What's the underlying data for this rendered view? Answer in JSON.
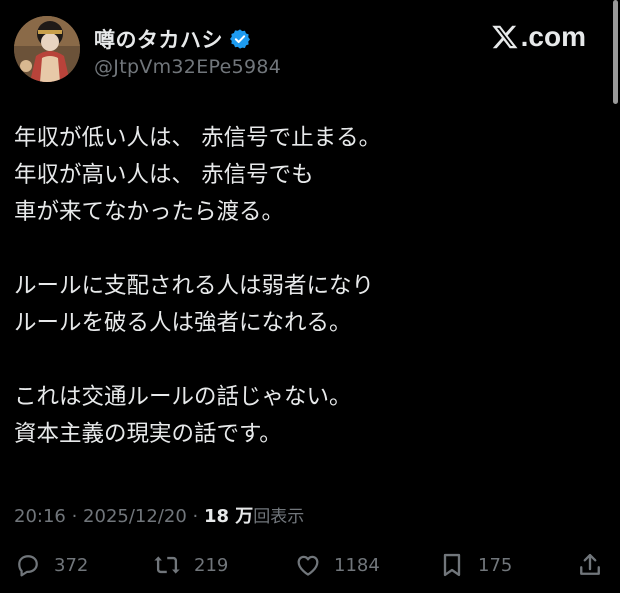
{
  "author": {
    "display_name": "噂のタカハシ",
    "handle": "@JtpVm32EPe5984",
    "verified": true,
    "avatar": "avatar-illustration-icon"
  },
  "watermark": {
    "logo": "x-logo-icon",
    "suffix": ".com"
  },
  "post": {
    "lines": [
      "年収が低い人は、 赤信号で止まる。",
      "年収が高い人は、 赤信号でも",
      "車が来てなかったら渡る。",
      "",
      "ルールに支配される人は弱者になり",
      "ルールを破る人は強者になれる。",
      "",
      "これは交通ルールの話じゃない。",
      "資本主義の現実の話です。"
    ]
  },
  "meta": {
    "time": "20:16",
    "separator1": " · ",
    "date": "2025/12/20",
    "separator2": " · ",
    "views_count": "18 万",
    "views_label": "回表示"
  },
  "actions": {
    "replies": "372",
    "reposts": "219",
    "likes": "1184",
    "bookmarks": "175"
  },
  "colors": {
    "background": "#000000",
    "text": "#e7e9ea",
    "secondary": "#71767b",
    "verified": "#1d9bf0"
  }
}
